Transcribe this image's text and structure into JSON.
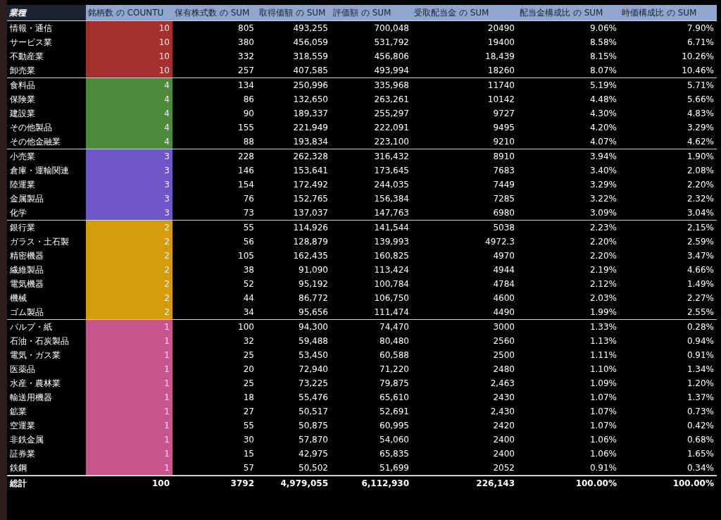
{
  "header": {
    "row_label": "業種",
    "columns": [
      "銘柄数 の COUNTU",
      "保有株式数 の SUM",
      "取得価額 の SUM",
      "評価額 の SUM",
      "受取配当金 の SUM",
      "配当金構成比 の SUM",
      "時価構成比 の SUM"
    ]
  },
  "groups": [
    {
      "color": "#a3302f",
      "rows": [
        {
          "industry": "情報・通信",
          "values": [
            "10",
            "805",
            "493,255",
            "700,048",
            "20490",
            "9.06%",
            "7.90%"
          ]
        },
        {
          "industry": "サービス業",
          "values": [
            "10",
            "380",
            "456,059",
            "531,792",
            "19400",
            "8.58%",
            "6.71%"
          ]
        },
        {
          "industry": "不動産業",
          "values": [
            "10",
            "332",
            "318,559",
            "456,806",
            "18,439",
            "8.15%",
            "10.26%"
          ]
        },
        {
          "industry": "卸売業",
          "values": [
            "10",
            "257",
            "407,585",
            "493,994",
            "18260",
            "8.07%",
            "10.46%"
          ]
        }
      ]
    },
    {
      "color": "#4e8a3b",
      "rows": [
        {
          "industry": "食料品",
          "values": [
            "4",
            "134",
            "250,996",
            "335,968",
            "11740",
            "5.19%",
            "5.71%"
          ]
        },
        {
          "industry": "保険業",
          "values": [
            "4",
            "86",
            "132,650",
            "263,261",
            "10142",
            "4.48%",
            "5.66%"
          ]
        },
        {
          "industry": "建設業",
          "values": [
            "4",
            "90",
            "189,337",
            "255,297",
            "9727",
            "4.30%",
            "4.83%"
          ]
        },
        {
          "industry": "その他製品",
          "values": [
            "4",
            "155",
            "221,949",
            "222,091",
            "9495",
            "4.20%",
            "3.29%"
          ]
        },
        {
          "industry": "その他金融業",
          "values": [
            "4",
            "88",
            "193,834",
            "223,100",
            "9210",
            "4.07%",
            "4.62%"
          ]
        }
      ]
    },
    {
      "color": "#6e56c6",
      "rows": [
        {
          "industry": "小売業",
          "values": [
            "3",
            "228",
            "262,328",
            "316,432",
            "8910",
            "3.94%",
            "1.90%"
          ]
        },
        {
          "industry": "倉庫・運輸関連",
          "values": [
            "3",
            "146",
            "153,641",
            "173,645",
            "7683",
            "3.40%",
            "2.08%"
          ]
        },
        {
          "industry": "陸運業",
          "values": [
            "3",
            "154",
            "172,492",
            "244,035",
            "7449",
            "3.29%",
            "2.20%"
          ]
        },
        {
          "industry": "金属製品",
          "values": [
            "3",
            "76",
            "152,765",
            "156,384",
            "7285",
            "3.22%",
            "2.32%"
          ]
        },
        {
          "industry": "化学",
          "values": [
            "3",
            "73",
            "137,037",
            "147,763",
            "6980",
            "3.09%",
            "3.04%"
          ]
        }
      ]
    },
    {
      "color": "#d49b0b",
      "rows": [
        {
          "industry": "銀行業",
          "values": [
            "2",
            "55",
            "114,926",
            "141,544",
            "5038",
            "2.23%",
            "2.15%"
          ]
        },
        {
          "industry": "ガラス・土石製",
          "values": [
            "2",
            "56",
            "128,879",
            "139,993",
            "4972.3",
            "2.20%",
            "2.59%"
          ]
        },
        {
          "industry": "精密機器",
          "values": [
            "2",
            "105",
            "162,435",
            "160,825",
            "4970",
            "2.20%",
            "3.47%"
          ]
        },
        {
          "industry": "繊維製品",
          "values": [
            "2",
            "38",
            "91,090",
            "113,424",
            "4944",
            "2.19%",
            "4.66%"
          ]
        },
        {
          "industry": "電気機器",
          "values": [
            "2",
            "52",
            "95,192",
            "100,784",
            "4784",
            "2.12%",
            "1.49%"
          ]
        },
        {
          "industry": "機械",
          "values": [
            "2",
            "44",
            "86,772",
            "106,750",
            "4600",
            "2.03%",
            "2.27%"
          ]
        },
        {
          "industry": "ゴム製品",
          "values": [
            "2",
            "34",
            "95,656",
            "111,474",
            "4490",
            "1.99%",
            "2.55%"
          ]
        }
      ]
    },
    {
      "color": "#c8568e",
      "rows": [
        {
          "industry": "パルプ・紙",
          "values": [
            "1",
            "100",
            "94,300",
            "74,470",
            "3000",
            "1.33%",
            "0.28%"
          ]
        },
        {
          "industry": "石油・石炭製品",
          "values": [
            "1",
            "32",
            "59,488",
            "80,480",
            "2560",
            "1.13%",
            "0.94%"
          ]
        },
        {
          "industry": "電気・ガス業",
          "values": [
            "1",
            "25",
            "53,450",
            "60,588",
            "2500",
            "1.11%",
            "0.91%"
          ]
        },
        {
          "industry": "医薬品",
          "values": [
            "1",
            "20",
            "72,940",
            "71,220",
            "2480",
            "1.10%",
            "1.34%"
          ]
        },
        {
          "industry": "水産・農林業",
          "values": [
            "1",
            "25",
            "73,225",
            "79,875",
            "2,463",
            "1.09%",
            "1.20%"
          ]
        },
        {
          "industry": "輸送用機器",
          "values": [
            "1",
            "18",
            "55,476",
            "65,610",
            "2430",
            "1.07%",
            "1.37%"
          ]
        },
        {
          "industry": "鉱業",
          "values": [
            "1",
            "27",
            "50,517",
            "52,691",
            "2,430",
            "1.07%",
            "0.73%"
          ]
        },
        {
          "industry": "空運業",
          "values": [
            "1",
            "55",
            "50,875",
            "60,995",
            "2420",
            "1.07%",
            "0.42%"
          ]
        },
        {
          "industry": "非鉄金属",
          "values": [
            "1",
            "30",
            "57,870",
            "54,060",
            "2400",
            "1.06%",
            "0.68%"
          ]
        },
        {
          "industry": "証券業",
          "values": [
            "1",
            "15",
            "42,975",
            "65,835",
            "2400",
            "1.06%",
            "1.65%"
          ]
        },
        {
          "industry": "鉄鋼",
          "values": [
            "1",
            "57",
            "50,502",
            "51,699",
            "2052",
            "0.91%",
            "0.34%"
          ]
        }
      ]
    }
  ],
  "total": {
    "label": "総計",
    "values": [
      "100",
      "3792",
      "4,979,055",
      "6,112,930",
      "226,143",
      "100.00%",
      "100.00%"
    ]
  }
}
